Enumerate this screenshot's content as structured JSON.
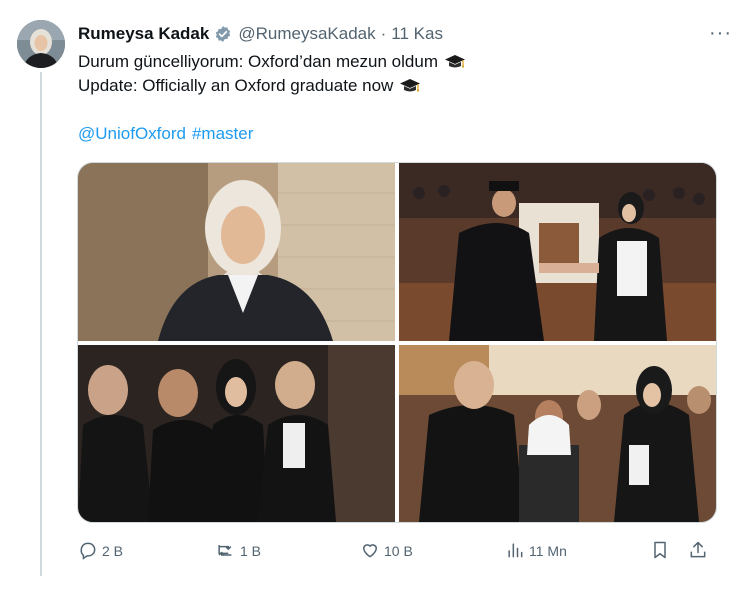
{
  "tweet": {
    "author_name": "Rumeysa Kadak",
    "handle": "@RumeysaKadak",
    "separator": "·",
    "date": "11 Kas",
    "more": "···",
    "line1": "Durum güncelliyorum: Oxford’dan mezun oldum",
    "line2": "Update: Officially an Oxford graduate now",
    "mention": "@UniofOxford",
    "hashtag": "#master"
  },
  "actions": {
    "replies": "2 B",
    "retweets": "1 B",
    "likes": "10 B",
    "views": "11 Mn"
  },
  "icons": {
    "verified": "verified-badge-icon",
    "cap": "graduation-cap-emoji",
    "reply": "reply-icon",
    "retweet": "retweet-icon",
    "like": "heart-icon",
    "views": "views-icon",
    "bookmark": "bookmark-icon",
    "share": "share-icon"
  },
  "colors": {
    "link": "#1d9bf0",
    "secondary_text": "#536471",
    "verified_badge": "#829aab"
  }
}
